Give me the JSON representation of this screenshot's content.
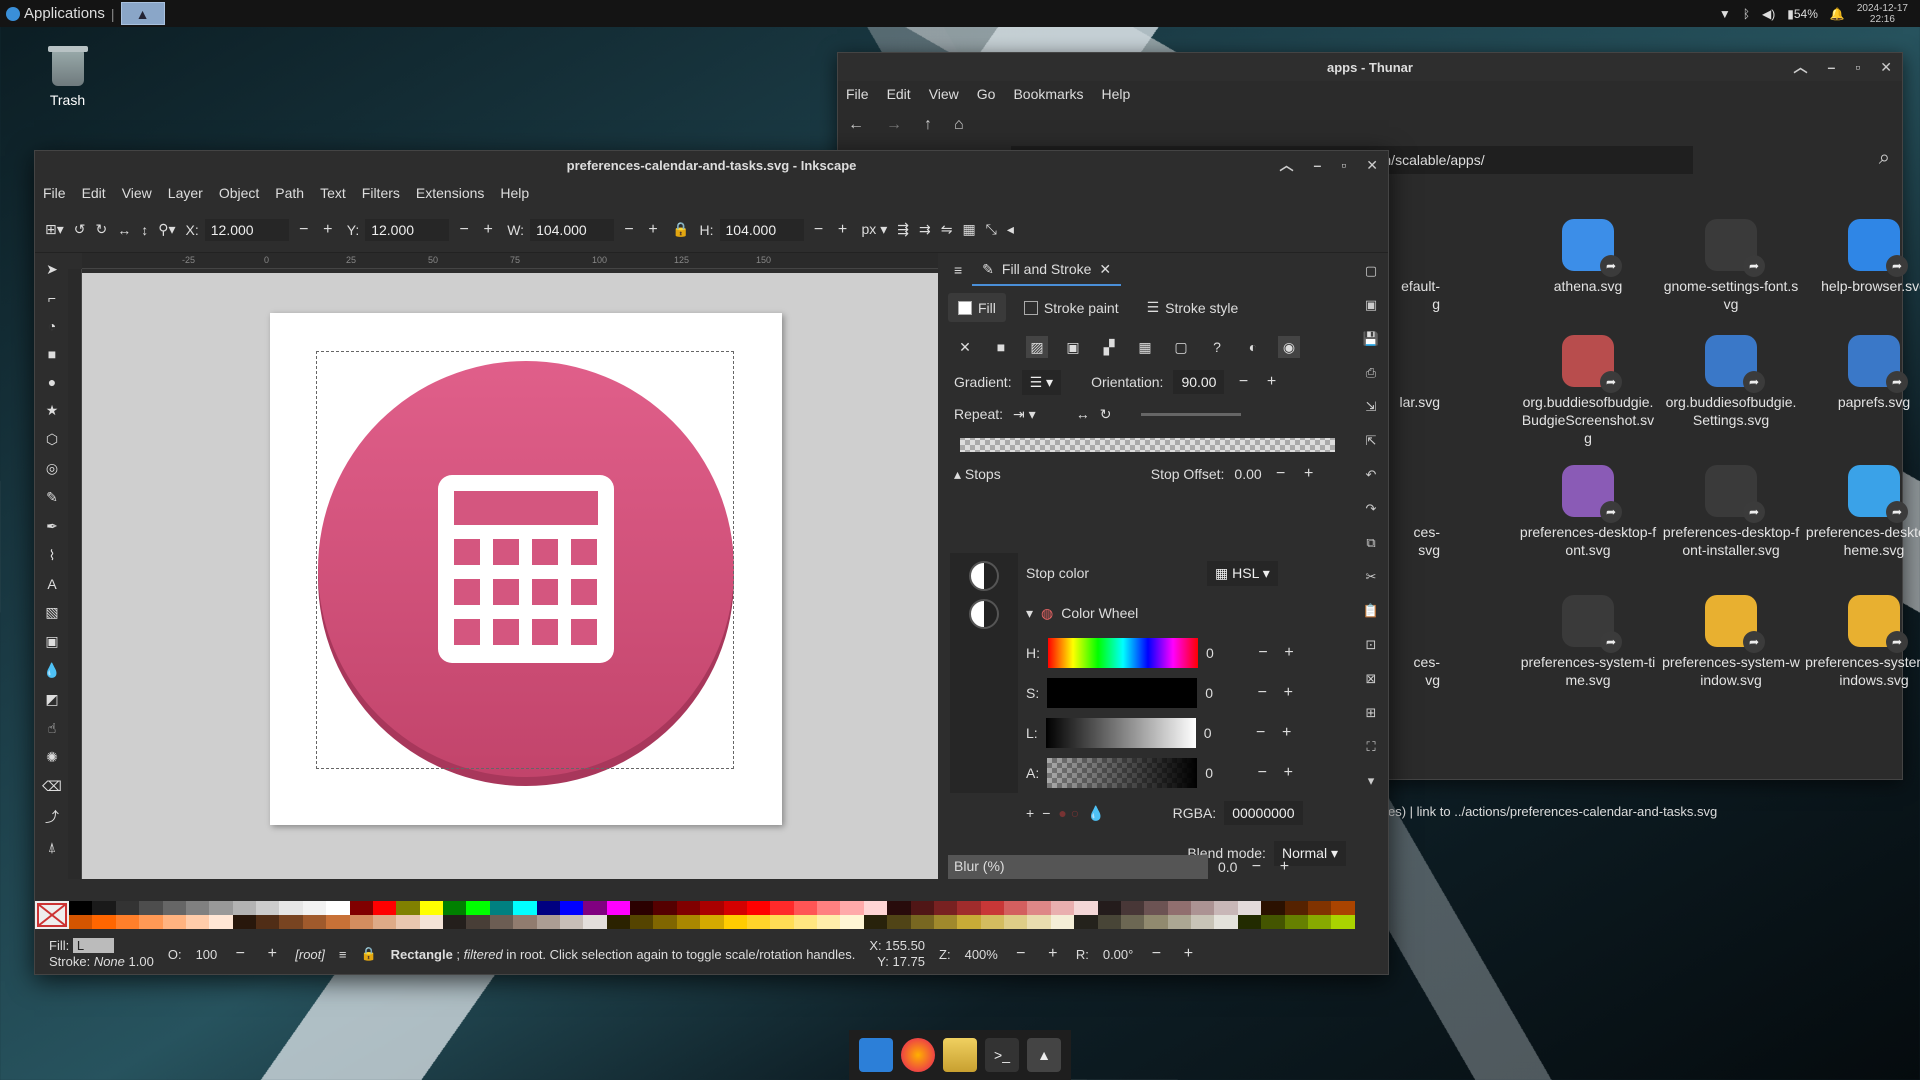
{
  "top_panel": {
    "apps_label": "Applications",
    "battery": "54%",
    "date": "2024-12-17",
    "time": "22:16"
  },
  "desktop": {
    "trash_label": "Trash"
  },
  "thunar": {
    "title": "apps - Thunar",
    "menu": [
      "File",
      "Edit",
      "View",
      "Go",
      "Bookmarks",
      "Help"
    ],
    "path": "/home/liveuser/Downloads/tau-hydrogen-main/Hydrogen/scalable/apps/",
    "items": [
      {
        "label": "efault-\ng",
        "partial": true
      },
      {
        "label": "athena.svg",
        "color": "#3c8ee8"
      },
      {
        "label": "gnome-settings-font.svg",
        "color": "#3a3a3a"
      },
      {
        "label": "help-browser.svg",
        "color": "#2f86e6"
      },
      {
        "label": "lar.svg",
        "partial": true
      },
      {
        "label": "org.buddiesofbudgie.BudgieScreenshot.svg",
        "color": "#b84d4d"
      },
      {
        "label": "org.buddiesofbudgie.Settings.svg",
        "color": "#3a78c8"
      },
      {
        "label": "paprefs.svg",
        "color": "#3a78c8"
      },
      {
        "label": "ces-\nsvg",
        "partial": true
      },
      {
        "label": "preferences-desktop-font.svg",
        "color": "#8a5bb6"
      },
      {
        "label": "preferences-desktop-font-installer.svg",
        "color": "#3a3a3a"
      },
      {
        "label": "preferences-desktop-theme.svg",
        "color": "#3aa2e8"
      },
      {
        "label": "ces-\nvg",
        "partial": true
      },
      {
        "label": "preferences-system-time.svg",
        "color": "#3a3a3a"
      },
      {
        "label": "preferences-system-window.svg",
        "color": "#e8b030"
      },
      {
        "label": "preferences-system-windows.svg",
        "color": "#e8b030"
      }
    ],
    "status": "es)  |  link to ../actions/preferences-calendar-and-tasks.svg"
  },
  "inkscape": {
    "title": "preferences-calendar-and-tasks.svg - Inkscape",
    "menu": [
      "File",
      "Edit",
      "View",
      "Layer",
      "Object",
      "Path",
      "Text",
      "Filters",
      "Extensions",
      "Help"
    ],
    "toolbar": {
      "x_label": "X:",
      "x": "12.000",
      "y_label": "Y:",
      "y": "12.000",
      "w_label": "W:",
      "w": "104.000",
      "h_label": "H:",
      "h": "104.000",
      "unit": "px"
    },
    "ruler_ticks": [
      "-25",
      "0",
      "25",
      "50",
      "75",
      "100",
      "125",
      "150"
    ],
    "dock": {
      "tab": "Fill and Stroke",
      "subtabs": [
        "Fill",
        "Stroke paint",
        "Stroke style"
      ],
      "gradient_label": "Gradient:",
      "orientation_label": "Orientation:",
      "orientation": "90.00",
      "repeat_label": "Repeat:",
      "stops_label": "Stops",
      "stop_offset_label": "Stop Offset:",
      "stop_offset": "0.00",
      "stop_color_label": "Stop color",
      "color_mode": "HSL",
      "color_wheel_label": "Color Wheel",
      "channels": [
        {
          "label": "H:",
          "value": "0"
        },
        {
          "label": "S:",
          "value": "0"
        },
        {
          "label": "L:",
          "value": "0"
        },
        {
          "label": "A:",
          "value": "0"
        }
      ],
      "rgba_label": "RGBA:",
      "rgba": "00000000",
      "blend_label": "Blend mode:",
      "blend": "Normal",
      "blur_label": "Blur (%)",
      "blur": "0.0"
    },
    "status": {
      "fill_label": "Fill:",
      "fill_val": "L",
      "stroke_label": "Stroke:",
      "stroke_val": "None",
      "stroke_w": "1.00",
      "opacity_label": "O:",
      "opacity": "100",
      "layer": "[root]",
      "msg_strong": "Rectangle",
      "msg_em": "filtered",
      "msg_rest": " in root. Click selection again to toggle scale/rotation handles.",
      "msg_sep": " ; ",
      "cx_label": "X:",
      "cx": "155.50",
      "cy_label": "Y:",
      "cy": "17.75",
      "zoom_label": "Z:",
      "zoom": "400%",
      "rot_label": "R:",
      "rot": "0.00°"
    },
    "palette": {
      "row1": [
        "#000000",
        "#1a1a1a",
        "#333333",
        "#4d4d4d",
        "#666666",
        "#808080",
        "#999999",
        "#b3b3b3",
        "#cccccc",
        "#e6e6e6",
        "#f2f2f2",
        "#ffffff",
        "#800000",
        "#ff0000",
        "#808000",
        "#ffff00",
        "#008000",
        "#00ff00",
        "#008080",
        "#00ffff",
        "#000080",
        "#0000ff",
        "#800080",
        "#ff00ff",
        "#2b0000",
        "#550000",
        "#800000",
        "#aa0000",
        "#d40000",
        "#ff0000",
        "#ff2a2a",
        "#ff5555",
        "#ff8080",
        "#ffaaaa",
        "#ffd5d5",
        "#280b0b",
        "#501616",
        "#782121",
        "#a02c2c",
        "#c83737",
        "#d35f5f",
        "#de8787",
        "#e9afaf",
        "#f4d7d7",
        "#241c1c",
        "#483737",
        "#6c5353",
        "#916f6f",
        "#ac9393",
        "#c8b7b7",
        "#e3dbdb",
        "#2b1100",
        "#552200",
        "#803300",
        "#aa4400"
      ],
      "row2": [
        "#d45500",
        "#ff6600",
        "#ff7f2a",
        "#ff9955",
        "#ffb380",
        "#ffccaa",
        "#ffe6d5",
        "#28170b",
        "#502d16",
        "#784421",
        "#a05a2c",
        "#c87137",
        "#d38d5f",
        "#deaa87",
        "#e9c6af",
        "#f4e3d7",
        "#241f1c",
        "#483e37",
        "#6c5d53",
        "#917c6f",
        "#ac9d93",
        "#c8beb7",
        "#e3dedb",
        "#2b2200",
        "#554400",
        "#806600",
        "#aa8800",
        "#d4aa00",
        "#ffcc00",
        "#ffd42a",
        "#ffdd55",
        "#ffe680",
        "#ffeeaa",
        "#fff6d5",
        "#28220b",
        "#504416",
        "#786721",
        "#a0892c",
        "#c8ab37",
        "#d3bc5f",
        "#decd87",
        "#e9ddaf",
        "#f4eed7",
        "#24221c",
        "#484537",
        "#6c6753",
        "#918a6f",
        "#aca793",
        "#c8c4b7",
        "#e3e2db",
        "#222b00",
        "#445500",
        "#668000",
        "#88aa00",
        "#aad400"
      ]
    }
  },
  "taskbar": [
    "files",
    "firefox",
    "thunar",
    "terminal",
    "inkscape"
  ]
}
